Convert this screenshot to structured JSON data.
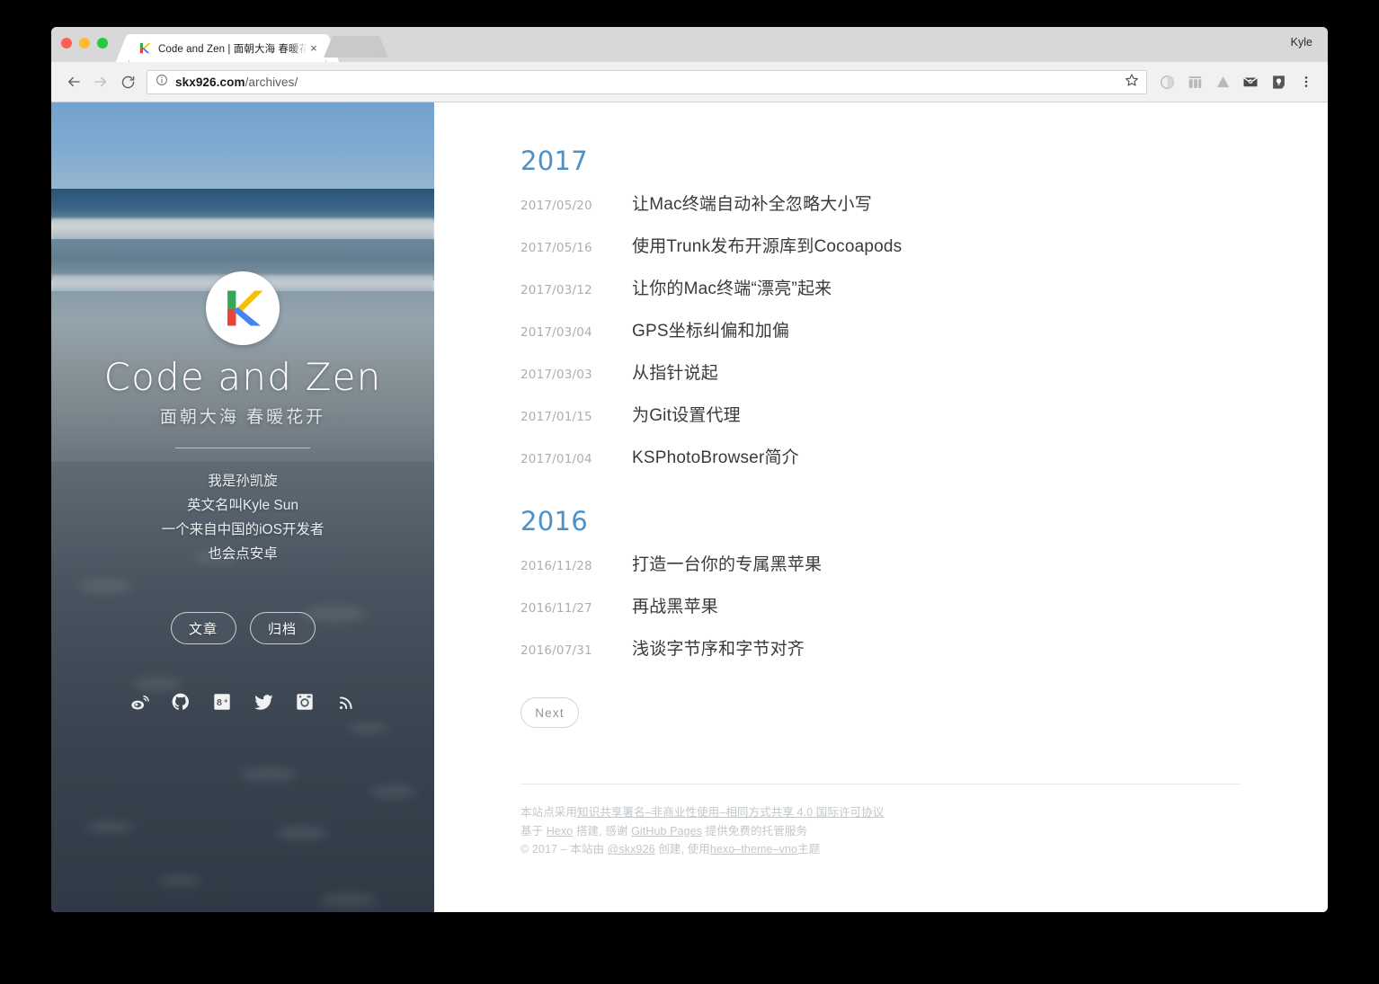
{
  "browser": {
    "tab": {
      "title": "Code and Zen | 面朝大海 春暖花…",
      "favicon": "k-logo-icon",
      "close_label": "×"
    },
    "profile_name": "Kyle",
    "omnibox": {
      "domain": "skx926.com",
      "path": "/archives/",
      "security_icon": "info-circle-icon"
    },
    "toolbar_icons": [
      "back-arrow-icon",
      "forward-arrow-icon",
      "reload-icon",
      "bookmark-star-icon",
      "extension-circle-icon",
      "extension-grid-icon",
      "google-drive-icon",
      "mail-envelope-icon",
      "google-keep-icon",
      "chrome-menu-icon"
    ]
  },
  "sidebar": {
    "logo_letter": "K",
    "site_title": "Code and Zen",
    "site_subtitle": "面朝大海 春暖花开",
    "bio": [
      "我是孙凯旋",
      "英文名叫Kyle Sun",
      "一个来自中国的iOS开发者",
      "也会点安卓"
    ],
    "nav_buttons": [
      {
        "label": "文章",
        "name": "nav-posts"
      },
      {
        "label": "归档",
        "name": "nav-archives"
      }
    ],
    "social": [
      {
        "name": "weibo-icon",
        "label": "Weibo"
      },
      {
        "name": "github-icon",
        "label": "GitHub"
      },
      {
        "name": "google-plus-icon",
        "label": "Google+"
      },
      {
        "name": "twitter-icon",
        "label": "Twitter"
      },
      {
        "name": "instagram-icon",
        "label": "Instagram"
      },
      {
        "name": "rss-icon",
        "label": "RSS"
      }
    ]
  },
  "main": {
    "groups": [
      {
        "year": "2017",
        "posts": [
          {
            "date": "2017/05/20",
            "title": "让Mac终端自动补全忽略大小写"
          },
          {
            "date": "2017/05/16",
            "title": "使用Trunk发布开源库到Cocoapods"
          },
          {
            "date": "2017/03/12",
            "title": "让你的Mac终端“漂亮”起来"
          },
          {
            "date": "2017/03/04",
            "title": "GPS坐标纠偏和加偏"
          },
          {
            "date": "2017/03/03",
            "title": "从指针说起"
          },
          {
            "date": "2017/01/15",
            "title": "为Git设置代理"
          },
          {
            "date": "2017/01/04",
            "title": "KSPhotoBrowser简介"
          }
        ]
      },
      {
        "year": "2016",
        "posts": [
          {
            "date": "2016/11/28",
            "title": "打造一台你的专属黑苹果"
          },
          {
            "date": "2016/11/27",
            "title": "再战黑苹果"
          },
          {
            "date": "2016/07/31",
            "title": "浅谈字节序和字节对齐"
          }
        ]
      }
    ],
    "next_label": "Next"
  },
  "footer": {
    "line1_pre": "本站点采用",
    "line1_link": "知识共享署名–非商业性使用–相同方式共享 4.0 国际许可协议",
    "line2_pre": "基于 ",
    "line2_link1": "Hexo",
    "line2_mid": " 搭建, 感谢 ",
    "line2_link2": "GitHub Pages",
    "line2_post": " 提供免费的托管服务",
    "line3_pre": "© 2017 – 本站由 ",
    "line3_link1": "@skx926",
    "line3_mid": " 创建, 使用",
    "line3_link2": "hexo–theme–vno",
    "line3_post": "主题"
  },
  "colors": {
    "year_blue": "#4c91c8",
    "sky": "#7cb0dd",
    "sand_dark": "#3b4550",
    "date_gray": "#a8afb5",
    "title_gray": "#3a3a3a",
    "footer_gray": "#c2c7cb"
  }
}
